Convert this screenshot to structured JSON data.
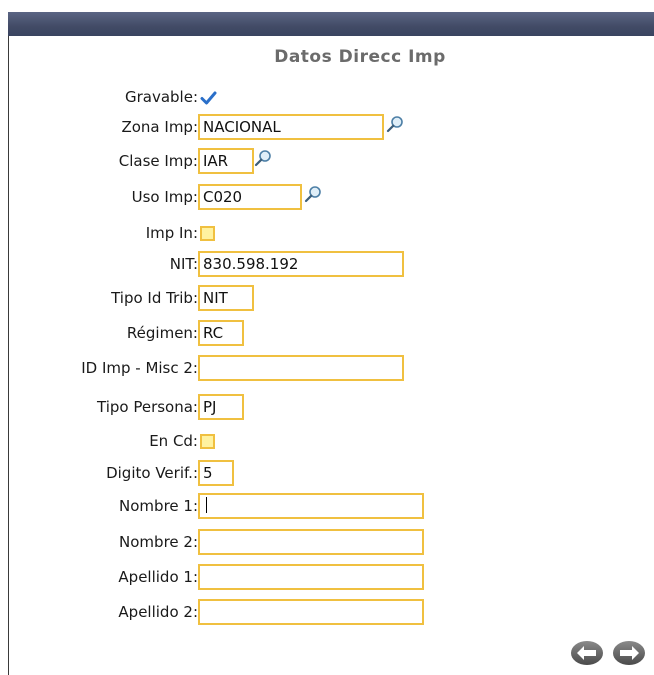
{
  "form": {
    "title": "Datos Direcc Imp",
    "fields": {
      "gravable": {
        "label": "Gravable:",
        "checked": true
      },
      "zona_imp": {
        "label": "Zona Imp:",
        "value": "NACIONAL"
      },
      "clase_imp": {
        "label": "Clase Imp:",
        "value": "IAR"
      },
      "uso_imp": {
        "label": "Uso Imp:",
        "value": "C020"
      },
      "imp_in": {
        "label": "Imp In:",
        "checked": false
      },
      "nit": {
        "label": "NIT:",
        "value": "830.598.192"
      },
      "tipo_id_trib": {
        "label": "Tipo Id Trib:",
        "value": "NIT"
      },
      "regimen": {
        "label": "Régimen:",
        "value": "RC"
      },
      "id_imp_misc2": {
        "label": "ID Imp - Misc 2:",
        "value": ""
      },
      "tipo_persona": {
        "label": "Tipo Persona:",
        "value": "PJ"
      },
      "en_cd": {
        "label": "En Cd:",
        "checked": false
      },
      "digito_verif": {
        "label": "Digito Verif.:",
        "value": "5"
      },
      "nombre1": {
        "label": "Nombre 1:",
        "value": ""
      },
      "nombre2": {
        "label": "Nombre 2:",
        "value": ""
      },
      "apellido1": {
        "label": "Apellido 1:",
        "value": ""
      },
      "apellido2": {
        "label": "Apellido 2:",
        "value": ""
      }
    }
  },
  "icons": {
    "lookup": "magnifier-icon",
    "previous": "arrow-left-icon",
    "next": "arrow-right-icon"
  },
  "colors": {
    "field_border": "#f0c040",
    "title_bar": "#424b66",
    "check_mark": "#2a6fc9",
    "nav_button": "#6e6e6e"
  }
}
